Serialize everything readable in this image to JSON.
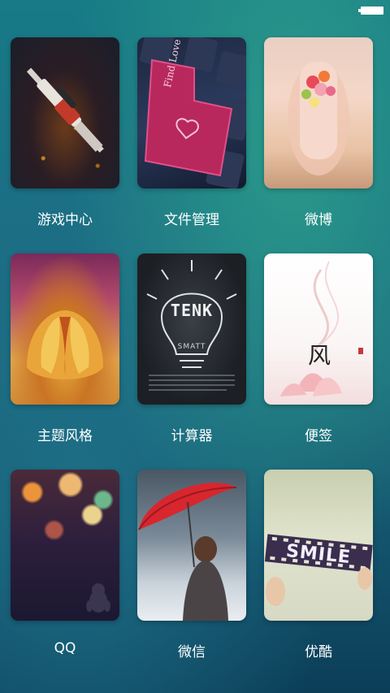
{
  "status_bar": {
    "battery_icon": "battery-icon"
  },
  "apps": [
    {
      "id": "game-center",
      "label": "游戏中心",
      "artwork": "rifle-artwork"
    },
    {
      "id": "file-manager",
      "label": "文件管理",
      "artwork": "keyboard-artwork",
      "art_text": "Find Love"
    },
    {
      "id": "weibo",
      "label": "微博",
      "artwork": "bouquet-artwork"
    },
    {
      "id": "theme-style",
      "label": "主题风格",
      "artwork": "tulip-artwork"
    },
    {
      "id": "calculator",
      "label": "计算器",
      "artwork": "lightbulb-chalk-artwork",
      "art_text": "TENK",
      "art_subtext": "SMATT"
    },
    {
      "id": "notes",
      "label": "便签",
      "artwork": "ink-lotus-artwork",
      "art_text": "风"
    },
    {
      "id": "qq",
      "label": "QQ",
      "artwork": "bokeh-penguin-artwork"
    },
    {
      "id": "wechat",
      "label": "微信",
      "artwork": "umbrella-girl-artwork"
    },
    {
      "id": "youku",
      "label": "优酷",
      "artwork": "smile-film-artwork",
      "art_text": "SMILE"
    }
  ]
}
